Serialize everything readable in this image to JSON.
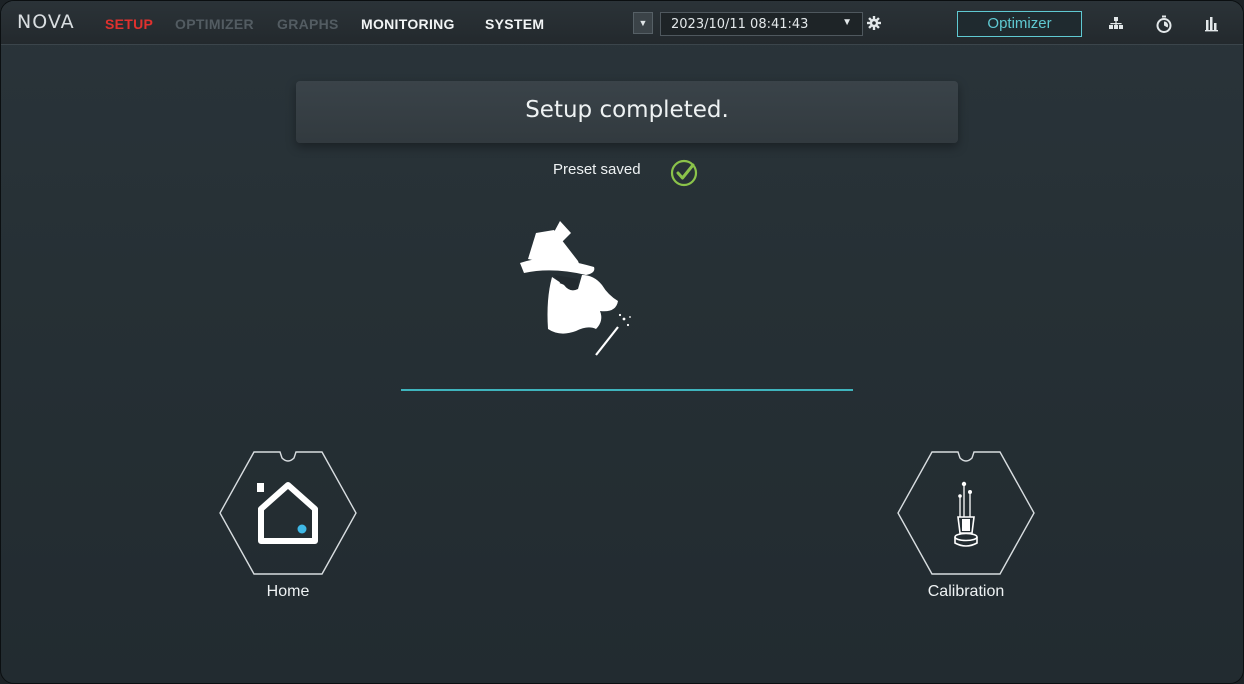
{
  "app": {
    "logo": "NOVA"
  },
  "nav": {
    "items": [
      {
        "label": "SETUP",
        "state": "active"
      },
      {
        "label": "OPTIMIZER",
        "state": "disabled"
      },
      {
        "label": "GRAPHS",
        "state": "disabled"
      },
      {
        "label": "MONITORING",
        "state": "enabled"
      },
      {
        "label": "SYSTEM",
        "state": "enabled"
      }
    ]
  },
  "toolbar": {
    "datetime": "2023/10/11 08:41:43",
    "optimizer_button": "Optimizer",
    "icons": [
      "network-icon",
      "stopwatch-icon",
      "bar-chart-icon"
    ]
  },
  "main": {
    "banner": "Setup completed.",
    "preset_status": "Preset saved"
  },
  "tiles": [
    {
      "label": "Home",
      "icon": "home-icon"
    },
    {
      "label": "Calibration",
      "icon": "calibration-icon"
    }
  ],
  "colors": {
    "accent": "#5fc9d2",
    "active_nav": "#e0312e",
    "success": "#8bc34a"
  }
}
